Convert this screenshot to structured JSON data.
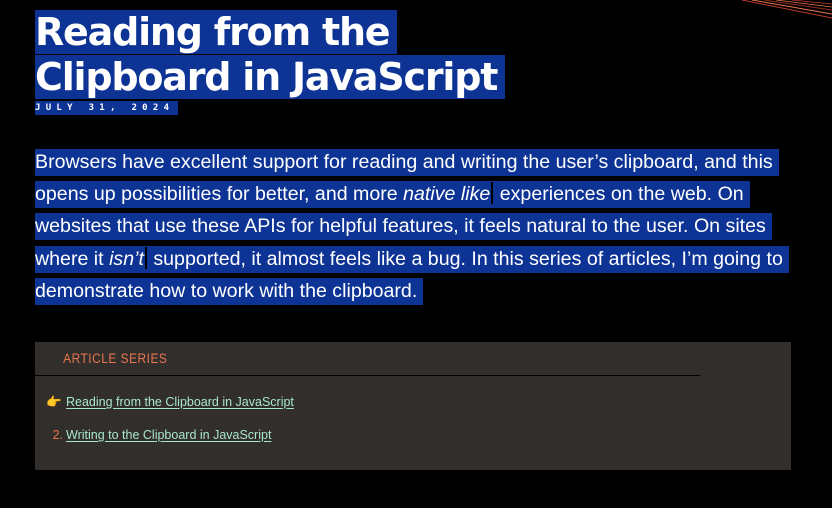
{
  "header": {
    "title": "Reading from the Clipboard in JavaScript",
    "date": "JULY 31, 2024"
  },
  "intro": {
    "text_before_native": "Browsers have excellent support for reading and writing the user’s clipboard, and this opens up possibilities for better, and more ",
    "native_like": "native like",
    "text_between": " experiences on the web. On websites that use these APIs for helpful features, it feels natural to the user. On sites where it ",
    "isnt": "isn’t",
    "text_after": " supported, it almost feels like a bug. In this series of articles, I’m going to demonstrate how to work with the clipboard."
  },
  "article_series": {
    "heading": "ARTICLE SERIES",
    "items": [
      {
        "marker": "👉",
        "label": "Reading from the Clipboard in JavaScript",
        "current": true
      },
      {
        "marker": "2.",
        "label": "Writing to the Clipboard in JavaScript",
        "current": false
      }
    ]
  },
  "colors": {
    "background": "#000000",
    "selection_highlight": "#0d3394",
    "series_background": "#322e2c",
    "series_heading": "#e8764e",
    "link": "#a8e6cf"
  }
}
